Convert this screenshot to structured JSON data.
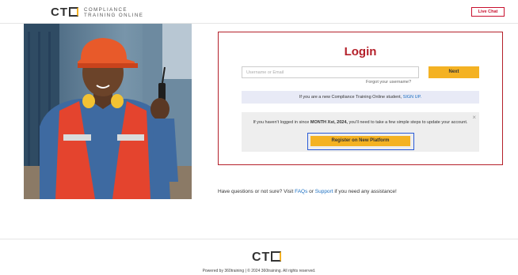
{
  "header": {
    "logo_mark": "CT",
    "logo_line1": "COMPLIANCE",
    "logo_line2": "TRAINING ONLINE",
    "live_chat_label": "Live Chat"
  },
  "hero": {
    "description_icon": "worker-photo"
  },
  "login": {
    "title": "Login",
    "username_placeholder": "Username or Email",
    "next_label": "Next",
    "forgot_label": "Forgot your username?",
    "new_student_text": "If you are a new Compliance Training Online student,",
    "sign_up_label": "SIGN UP.",
    "notice_part1": "If you haven't logged in since ",
    "notice_bold": "MONTH Xst, 2024,",
    "notice_part2": " you'll need to take a few simple steps to update your account.",
    "close_label": "×",
    "register_label": "Register on New Platform"
  },
  "help": {
    "prefix": "Have questions or not sure? Visit ",
    "faqs_label": "FAQs",
    "or_text": " or ",
    "support_label": "Support",
    "suffix": " if you need any assistance!"
  },
  "footer": {
    "logo_mark": "CT",
    "copyright": "Powered by 360training | © 2024 360training. All rights reserved."
  },
  "colors": {
    "brand_red": "#b4202a",
    "accent_yellow": "#f4b223",
    "link_blue": "#1b6fc2",
    "highlight_blue": "#2a5bd7"
  }
}
